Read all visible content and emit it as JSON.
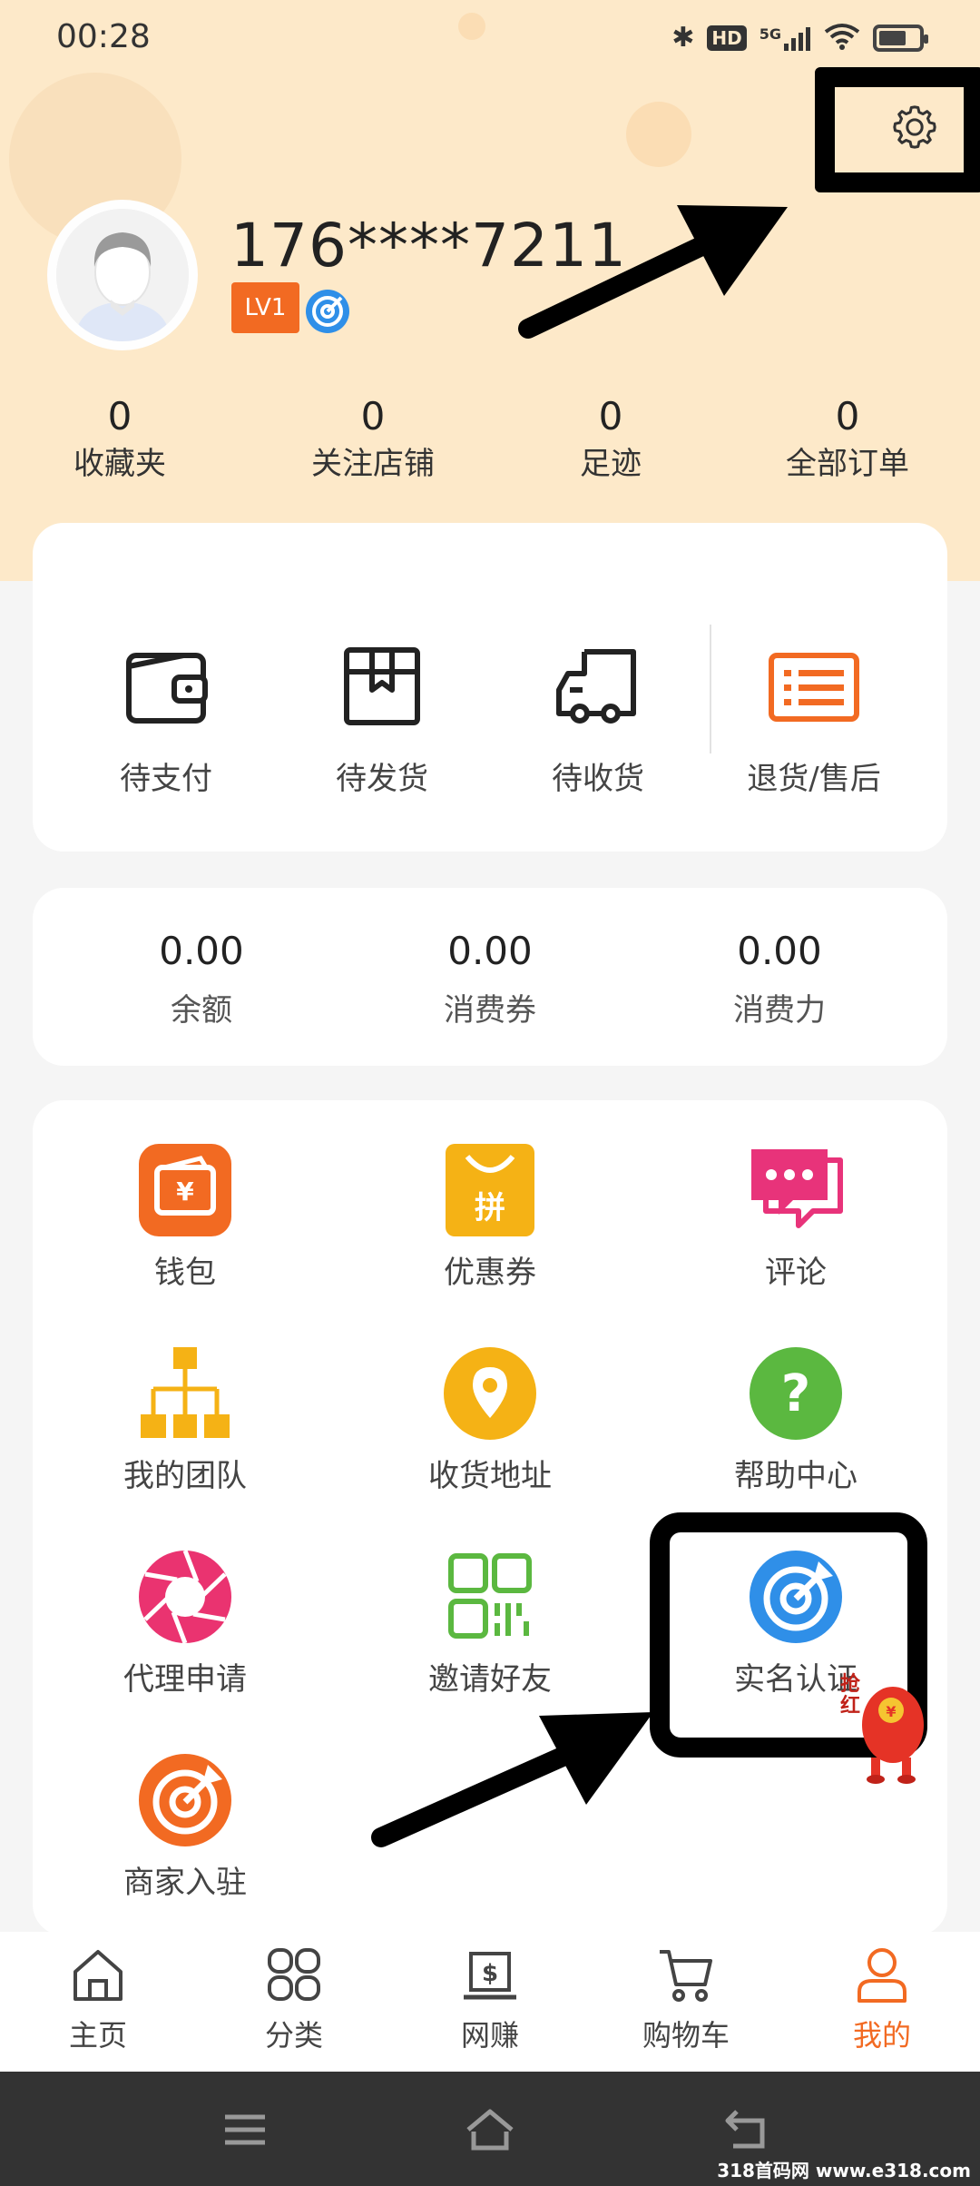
{
  "status_bar": {
    "time": "00:28",
    "network": "5G"
  },
  "profile": {
    "phone": "176****7211",
    "level": "LV1"
  },
  "stats": [
    {
      "value": "0",
      "label": "收藏夹"
    },
    {
      "value": "0",
      "label": "关注店铺"
    },
    {
      "value": "0",
      "label": "足迹"
    },
    {
      "value": "0",
      "label": "全部订单"
    }
  ],
  "orders": [
    {
      "label": "待支付",
      "icon": "wallet-icon"
    },
    {
      "label": "待发货",
      "icon": "box-icon"
    },
    {
      "label": "待收货",
      "icon": "truck-icon"
    },
    {
      "label": "退货/售后",
      "icon": "return-list-icon"
    }
  ],
  "balances": [
    {
      "value": "0.00",
      "label": "余额"
    },
    {
      "value": "0.00",
      "label": "消费券"
    },
    {
      "value": "0.00",
      "label": "消费力"
    }
  ],
  "menu": [
    {
      "label": "钱包",
      "icon": "wallet-ticket-icon"
    },
    {
      "label": "优惠券",
      "icon": "coupon-bag-icon",
      "icon_text": "拼"
    },
    {
      "label": "评论",
      "icon": "comment-icon"
    },
    {
      "label": "我的团队",
      "icon": "team-tree-icon"
    },
    {
      "label": "收货地址",
      "icon": "location-pin-icon"
    },
    {
      "label": "帮助中心",
      "icon": "help-icon"
    },
    {
      "label": "代理申请",
      "icon": "aperture-icon"
    },
    {
      "label": "邀请好友",
      "icon": "qr-code-icon"
    },
    {
      "label": "实名认证",
      "icon": "target-icon"
    },
    {
      "label": "商家入驻",
      "icon": "target-icon"
    }
  ],
  "tabs": [
    {
      "label": "主页",
      "icon": "home-icon"
    },
    {
      "label": "分类",
      "icon": "grid-icon"
    },
    {
      "label": "网赚",
      "icon": "money-monitor-icon"
    },
    {
      "label": "购物车",
      "icon": "cart-icon"
    },
    {
      "label": "我的",
      "icon": "person-icon",
      "active": true
    }
  ],
  "mascot_text": "抢红",
  "watermark": "318首码网 www.e318.com",
  "colors": {
    "accent": "#f26a22",
    "header_bg": "#fde9c9",
    "blue": "#2f8fe8"
  }
}
